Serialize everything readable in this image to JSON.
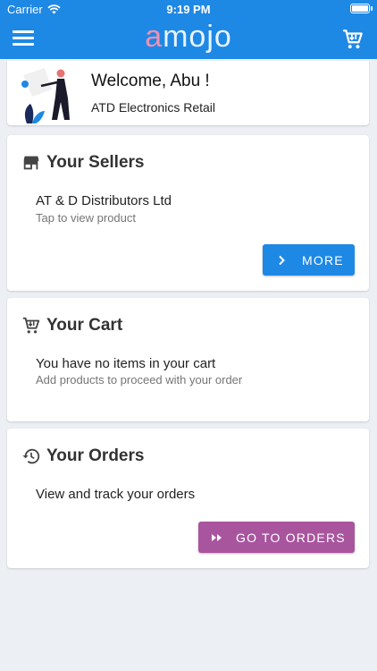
{
  "status_bar": {
    "carrier": "Carrier",
    "time": "9:19 PM"
  },
  "app_bar": {
    "logo_first": "a",
    "logo_rest": "mojo",
    "logo_accent": "#f48fb1",
    "bar_color": "#1e88e5"
  },
  "welcome": {
    "title": "Welcome, Abu !",
    "subtitle": "ATD Electronics Retail"
  },
  "sellers": {
    "title": "Your Sellers",
    "item_title": "AT & D Distributors Ltd",
    "item_subtitle": "Tap to view product",
    "button_label": "MORE",
    "button_color": "#1e88e5"
  },
  "cart": {
    "title": "Your Cart",
    "item_title": "You have no items in your cart",
    "item_subtitle": "Add products to proceed with your order"
  },
  "orders": {
    "title": "Your Orders",
    "item_title": "View and track your orders",
    "button_label": "GO TO ORDERS",
    "button_color": "#a8559e"
  },
  "icons": [
    "wifi-icon",
    "battery-icon",
    "menu-icon",
    "cart-icon",
    "store-icon",
    "history-icon",
    "chevron-right-icon",
    "fast-forward-icon"
  ]
}
